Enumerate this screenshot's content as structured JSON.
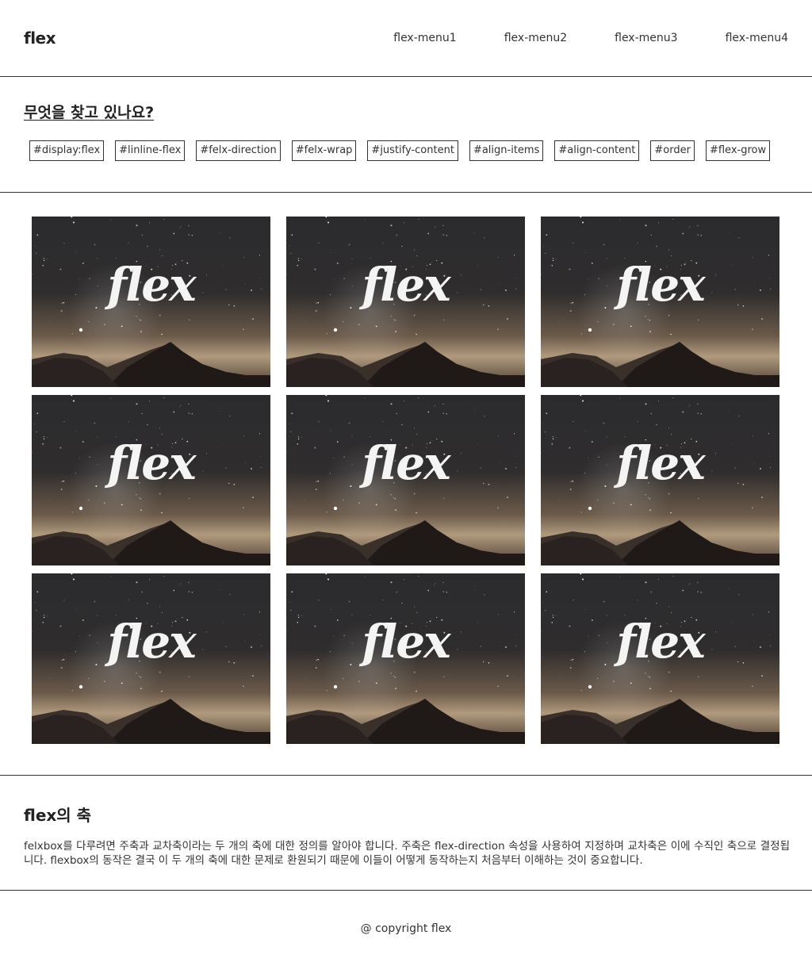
{
  "header": {
    "logo": "flex",
    "menu": [
      "flex-menu1",
      "flex-menu2",
      "flex-menu3",
      "flex-menu4"
    ]
  },
  "search": {
    "title": "무엇을 찾고 있나요?",
    "tags": [
      "#display:flex",
      "#linline-flex",
      "#felx-direction",
      "#felx-wrap",
      "#justify-content",
      "#align-items",
      "#align-content",
      "#order",
      "#flex-grow"
    ]
  },
  "gallery": {
    "card_text": "flex",
    "count": 9
  },
  "about": {
    "title": "flex의 축",
    "body": "felxbox를 다루려면 주축과 교차축이라는 두 개의 축에 대한 정의를 알아야 합니다. 주축은 flex-direction 속성을 사용하여 지정하며 교차축은 이에 수직인 축으로 결정됩니다. flexbox의 동작은 결국 이 두 개의 축에 대한 문제로 환원되기 때문에 이들이 어떻게 동작하는지 처음부터 이해하는 것이 중요합니다."
  },
  "footer": {
    "copyright": "@ copyright flex"
  }
}
